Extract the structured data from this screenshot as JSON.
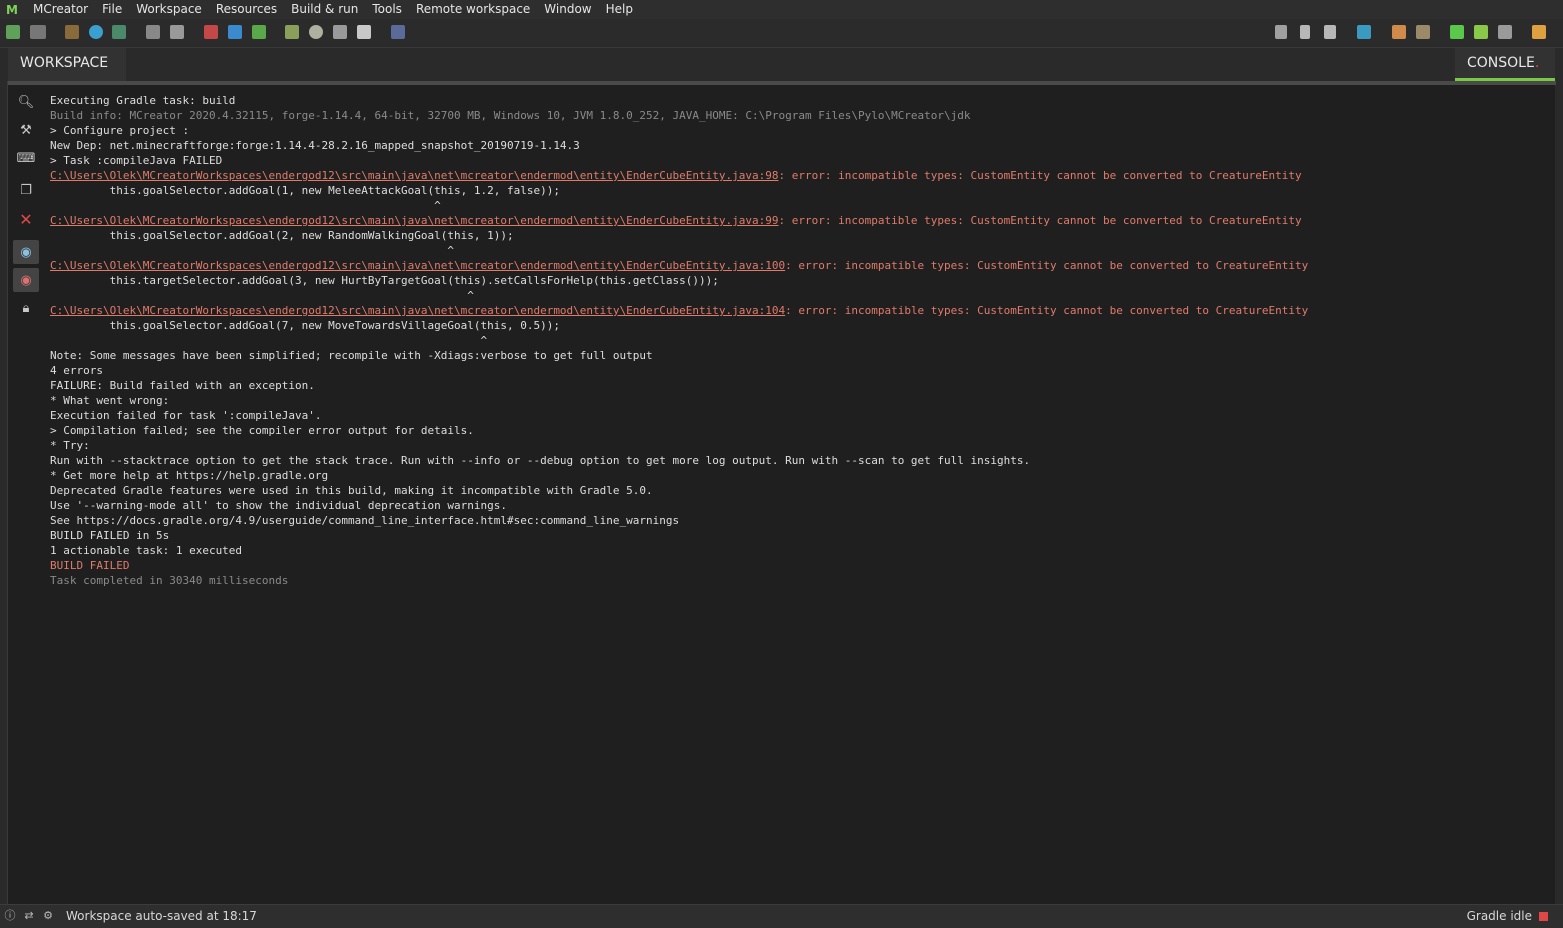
{
  "app": {
    "logo": "M"
  },
  "menu": [
    "MCreator",
    "File",
    "Workspace",
    "Resources",
    "Build & run",
    "Tools",
    "Remote workspace",
    "Window",
    "Help"
  ],
  "tabs": {
    "workspace": "WORKSPACE",
    "console": "CONSOLE",
    "console_marker": "."
  },
  "console": {
    "lines": [
      {
        "cls": "white",
        "text": "Executing Gradle task: build"
      },
      {
        "cls": "gray",
        "text": "Build info: MCreator 2020.4.32115, forge-1.14.4, 64-bit, 32700 MB, Windows 10, JVM 1.8.0_252, JAVA_HOME: C:\\Program Files\\Pylo\\MCreator\\jdk"
      },
      {
        "cls": "white",
        "text": "> Configure project :"
      },
      {
        "cls": "white",
        "text": "New Dep: net.minecraftforge:forge:1.14.4-28.2.16_mapped_snapshot_20190719-1.14.3"
      },
      {
        "cls": "white",
        "text": "> Task :compileJava FAILED"
      },
      {
        "cls": "red",
        "link": "C:\\Users\\Olek\\MCreatorWorkspaces\\endergod12\\src\\main\\java\\net\\mcreator\\endermod\\entity\\EnderCubeEntity.java:98",
        "text": ": error: incompatible types: CustomEntity cannot be converted to CreatureEntity"
      },
      {
        "cls": "white",
        "text": "         this.goalSelector.addGoal(1, new MeleeAttackGoal(this, 1.2, false));"
      },
      {
        "cls": "white",
        "text": "                                                          ^"
      },
      {
        "cls": "red",
        "link": "C:\\Users\\Olek\\MCreatorWorkspaces\\endergod12\\src\\main\\java\\net\\mcreator\\endermod\\entity\\EnderCubeEntity.java:99",
        "text": ": error: incompatible types: CustomEntity cannot be converted to CreatureEntity"
      },
      {
        "cls": "white",
        "text": "         this.goalSelector.addGoal(2, new RandomWalkingGoal(this, 1));"
      },
      {
        "cls": "white",
        "text": "                                                            ^"
      },
      {
        "cls": "red",
        "link": "C:\\Users\\Olek\\MCreatorWorkspaces\\endergod12\\src\\main\\java\\net\\mcreator\\endermod\\entity\\EnderCubeEntity.java:100",
        "text": ": error: incompatible types: CustomEntity cannot be converted to CreatureEntity"
      },
      {
        "cls": "white",
        "text": "         this.targetSelector.addGoal(3, new HurtByTargetGoal(this).setCallsForHelp(this.getClass()));"
      },
      {
        "cls": "white",
        "text": "                                                               ^"
      },
      {
        "cls": "red",
        "link": "C:\\Users\\Olek\\MCreatorWorkspaces\\endergod12\\src\\main\\java\\net\\mcreator\\endermod\\entity\\EnderCubeEntity.java:104",
        "text": ": error: incompatible types: CustomEntity cannot be converted to CreatureEntity"
      },
      {
        "cls": "white",
        "text": "         this.goalSelector.addGoal(7, new MoveTowardsVillageGoal(this, 0.5));"
      },
      {
        "cls": "white",
        "text": "                                                                 ^"
      },
      {
        "cls": "white",
        "text": "Note: Some messages have been simplified; recompile with -Xdiags:verbose to get full output"
      },
      {
        "cls": "white",
        "text": "4 errors"
      },
      {
        "cls": "white",
        "text": "FAILURE: Build failed with an exception."
      },
      {
        "cls": "white",
        "text": "* What went wrong:"
      },
      {
        "cls": "white",
        "text": "Execution failed for task ':compileJava'."
      },
      {
        "cls": "white",
        "text": "> Compilation failed; see the compiler error output for details."
      },
      {
        "cls": "white",
        "text": "* Try:"
      },
      {
        "cls": "white",
        "text": "Run with --stacktrace option to get the stack trace. Run with --info or --debug option to get more log output. Run with --scan to get full insights."
      },
      {
        "cls": "white",
        "text": "* Get more help at https://help.gradle.org"
      },
      {
        "cls": "white",
        "text": "Deprecated Gradle features were used in this build, making it incompatible with Gradle 5.0."
      },
      {
        "cls": "white",
        "text": "Use '--warning-mode all' to show the individual deprecation warnings."
      },
      {
        "cls": "white",
        "text": "See https://docs.gradle.org/4.9/userguide/command_line_interface.html#sec:command_line_warnings"
      },
      {
        "cls": "white",
        "text": "BUILD FAILED in 5s"
      },
      {
        "cls": "white",
        "text": "1 actionable task: 1 executed"
      },
      {
        "cls": "red",
        "text": "BUILD FAILED"
      },
      {
        "cls": "gray",
        "text": "Task completed in 30340 milliseconds"
      }
    ]
  },
  "status": {
    "message": "Workspace auto-saved at 18:17",
    "gradle": "Gradle idle",
    "gradle_color": "#e04848"
  },
  "colors": {
    "accent_green": "#7ac943",
    "error_red": "#e07b6a"
  }
}
